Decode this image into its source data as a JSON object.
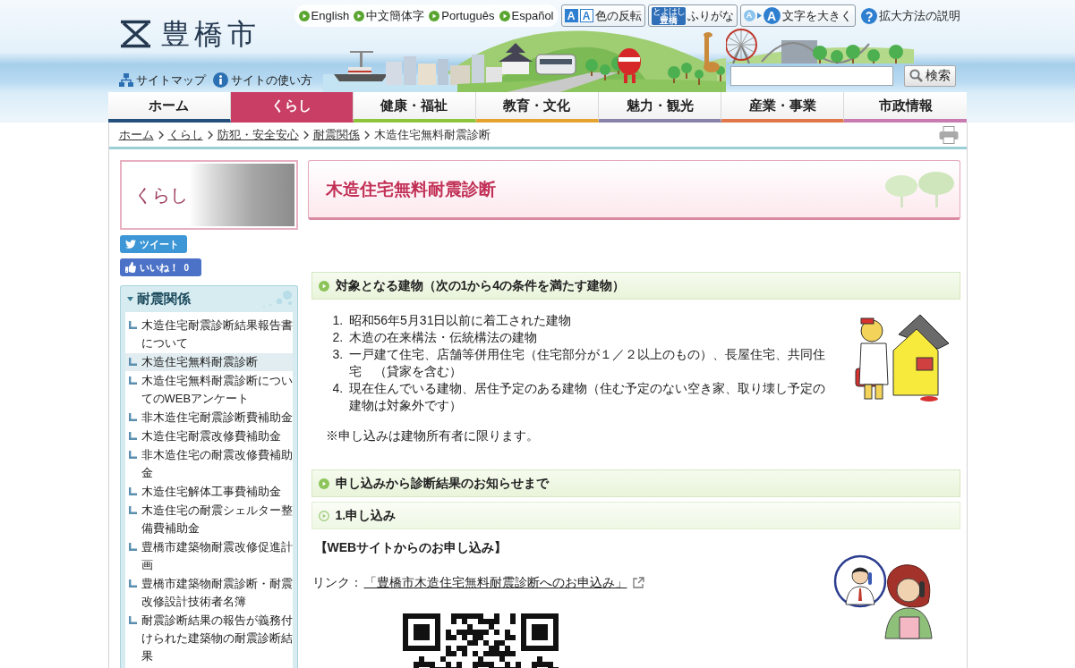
{
  "header": {
    "logo": "豊橋市",
    "languages": [
      "English",
      "中文簡体字",
      "Português",
      "Español"
    ],
    "tools": [
      {
        "kind": "invert",
        "badges": [
          "A",
          "A"
        ],
        "label": "色の反転"
      },
      {
        "kind": "furigana",
        "badges": [
          "とよはし",
          "豊橋"
        ],
        "label": "ふりがな"
      },
      {
        "kind": "zoom",
        "badges": [
          "A",
          "A"
        ],
        "label": "文字を大きく"
      },
      {
        "kind": "help",
        "label": "拡大方法の説明"
      }
    ],
    "links": [
      {
        "kind": "sitemap",
        "label": "サイトマップ"
      },
      {
        "kind": "guide",
        "label": "サイトの使い方"
      }
    ],
    "search": {
      "button": "検索"
    }
  },
  "nav": [
    {
      "label": "ホーム",
      "selected": false,
      "color": "#244f7d"
    },
    {
      "label": "くらし",
      "selected": true,
      "color": "#c83e65"
    },
    {
      "label": "健康・福祉",
      "selected": false,
      "color": "#8dc43c"
    },
    {
      "label": "教育・文化",
      "selected": false,
      "color": "#e3a32e"
    },
    {
      "label": "魅力・観光",
      "selected": false,
      "color": "#8a82a8"
    },
    {
      "label": "産業・事業",
      "selected": false,
      "color": "#e0784a"
    },
    {
      "label": "市政情報",
      "selected": false,
      "color": "#c77bb0"
    }
  ],
  "breadcrumb": [
    {
      "label": "ホーム",
      "current": false
    },
    {
      "label": "くらし",
      "current": false
    },
    {
      "label": "防犯・安全安心",
      "current": false
    },
    {
      "label": "耐震関係",
      "current": false
    },
    {
      "label": "木造住宅無料耐震診断",
      "current": true
    }
  ],
  "sidebar": {
    "banner": "くらし",
    "tweet": "ツイート",
    "like": {
      "label": "いいね！",
      "count": "0"
    },
    "menu": {
      "title": "耐震関係",
      "items": [
        {
          "label": "木造住宅耐震診断結果報告書について",
          "selected": false
        },
        {
          "label": "木造住宅無料耐震診断",
          "selected": true
        },
        {
          "label": "木造住宅無料耐震診断についてのWEBアンケート",
          "selected": false
        },
        {
          "label": "非木造住宅耐震診断費補助金",
          "selected": false
        },
        {
          "label": "木造住宅耐震改修費補助金",
          "selected": false
        },
        {
          "label": "非木造住宅の耐震改修費補助金",
          "selected": false
        },
        {
          "label": "木造住宅解体工事費補助金",
          "selected": false
        },
        {
          "label": "木造住宅の耐震シェルター整備費補助金",
          "selected": false
        },
        {
          "label": "豊橋市建築物耐震改修促進計画",
          "selected": false
        },
        {
          "label": "豊橋市建築物耐震診断・耐震改修設計技術者名簿",
          "selected": false
        },
        {
          "label": "耐震診断結果の報告が義務付けられた建築物の耐震診断結果",
          "selected": false
        }
      ]
    }
  },
  "main": {
    "title": "木造住宅無料耐震診断",
    "target": {
      "heading": "対象となる建物（次の1から4の条件を満たす建物）",
      "items": [
        {
          "number": "1.",
          "text": "昭和56年5月31日以前に着工された建物"
        },
        {
          "number": "2.",
          "text": "木造の在来構法・伝統構法の建物"
        },
        {
          "number": "3.",
          "text": "一戸建て住宅、店舗等併用住宅（住宅部分が１／２以上のもの）、長屋住宅、共同住宅　（貸家を含む）"
        },
        {
          "number": "4.",
          "text": "現在住んでいる建物、居住予定のある建物（住む予定のない空き家、取り壊し予定の建物は対象外です）"
        }
      ],
      "note": "※申し込みは建物所有者に限ります。"
    },
    "process": {
      "heading": "申し込みから診断結果のお知らせまで",
      "step": {
        "heading": "1.申し込み",
        "web_label": "【WEBサイトからのお申し込み】",
        "link_prefix": "リンク：",
        "link_text": "「豊橋市木造住宅無料耐震診断へのお申込み」"
      }
    }
  }
}
